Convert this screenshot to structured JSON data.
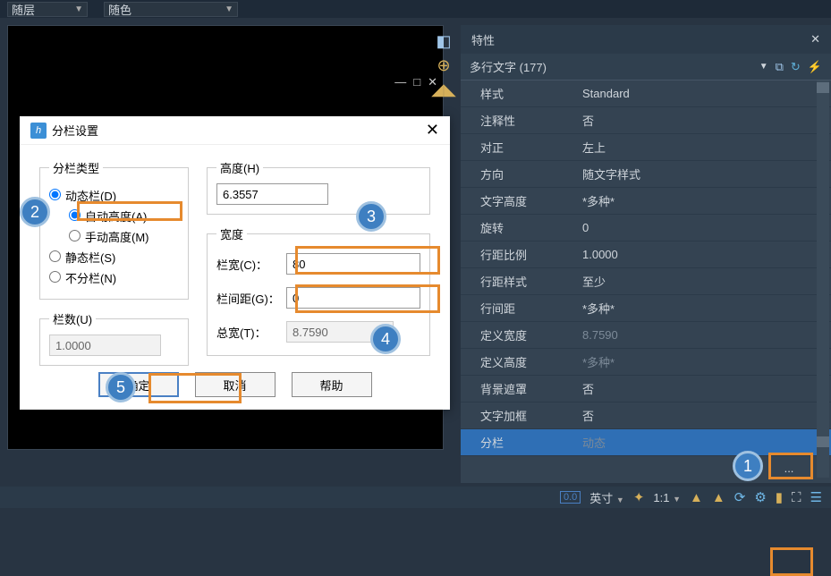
{
  "top": {
    "layer": "随层",
    "color": "随色"
  },
  "dialog": {
    "title": "分栏设置",
    "group_type": "分栏类型",
    "opt_dynamic": "动态栏(D)",
    "opt_autoheight": "自动高度(A)",
    "opt_manualheight": "手动高度(M)",
    "opt_static": "静态栏(S)",
    "opt_none": "不分栏(N)",
    "group_cols": "栏数(U)",
    "cols_val": "1.0000",
    "group_height": "高度(H)",
    "height_val": "6.3557",
    "group_width": "宽度",
    "lbl_colwidth": "栏宽(C)：",
    "colwidth_val": "80",
    "lbl_colgap": "栏间距(G)：",
    "colgap_val": "0",
    "lbl_total": "总宽(T)：",
    "total_val": "8.7590",
    "ok": "确定",
    "cancel": "取消",
    "help": "帮助"
  },
  "props": {
    "title": "特性",
    "selector": "多行文字 (177)",
    "rows": [
      {
        "k": "样式",
        "v": "Standard"
      },
      {
        "k": "注释性",
        "v": "否"
      },
      {
        "k": "对正",
        "v": "左上"
      },
      {
        "k": "方向",
        "v": "随文字样式"
      },
      {
        "k": "文字高度",
        "v": "*多种*"
      },
      {
        "k": "旋转",
        "v": "0"
      },
      {
        "k": "行距比例",
        "v": "1.0000"
      },
      {
        "k": "行距样式",
        "v": "至少"
      },
      {
        "k": "行间距",
        "v": "*多种*"
      },
      {
        "k": "定义宽度",
        "v": "8.7590",
        "dim": true
      },
      {
        "k": "定义高度",
        "v": "*多种*",
        "dim": true
      },
      {
        "k": "背景遮罩",
        "v": "否"
      },
      {
        "k": "文字加框",
        "v": "否"
      },
      {
        "k": "分栏",
        "v": "动态",
        "sel": true,
        "dim": true
      }
    ],
    "more": "..."
  },
  "status": {
    "unit": "英寸",
    "ratio": "1:1",
    "zero": "0.0"
  },
  "badges": {
    "b1": "1",
    "b2": "2",
    "b3": "3",
    "b4": "4",
    "b5": "5"
  }
}
